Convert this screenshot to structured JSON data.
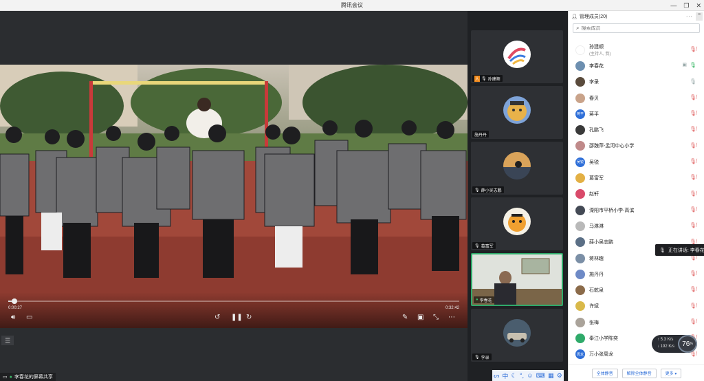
{
  "window": {
    "title": "腾讯会议",
    "controls": [
      "—",
      "❐",
      "✕"
    ]
  },
  "video": {
    "time_current": "0:00:27",
    "time_total": "0:32:42",
    "progress": 0.014,
    "share_label": "李春花的屏幕共享"
  },
  "strip": {
    "tiles": [
      {
        "name": "孙建顺",
        "icon": "host-avatar-icon"
      },
      {
        "name": "施丹丹",
        "icon": ""
      },
      {
        "name": "薛小吴志鹏",
        "icon": "mic-icon"
      },
      {
        "name": "葛富军",
        "icon": "mic-icon"
      },
      {
        "name": "李春花",
        "icon": "mic-icon"
      },
      {
        "name": "李录",
        "icon": "mic-icon"
      }
    ],
    "toolbar_chars": [
      "中"
    ]
  },
  "panel": {
    "title": "管理成员(20)",
    "more": "···",
    "search_placeholder": "搜索成员",
    "members": [
      {
        "name": "孙建顺",
        "sub": "(主持人, 我)",
        "avatar_text": "",
        "avatar_color": "#ffffff",
        "mic": "muted"
      },
      {
        "name": "李春花",
        "sub": "",
        "avatar_text": "",
        "avatar_color": "#6d8fb0",
        "mic": "green"
      },
      {
        "name": "李录",
        "sub": "",
        "avatar_text": "",
        "avatar_color": "#5a4b3c",
        "mic": "on"
      },
      {
        "name": "春贝",
        "sub": "",
        "avatar_text": "",
        "avatar_color": "#c9a38a",
        "mic": "muted"
      },
      {
        "name": "蒋平",
        "sub": "",
        "avatar_text": "蒋平",
        "avatar_color": "#2f6fd8",
        "mic": "muted"
      },
      {
        "name": "孔鹏飞",
        "sub": "",
        "avatar_text": "",
        "avatar_color": "#3a3a3a",
        "mic": "muted"
      },
      {
        "name": "邵魏萍-孟河中心小学",
        "sub": "",
        "avatar_text": "",
        "avatar_color": "#c08a8a",
        "mic": "muted"
      },
      {
        "name": "吴锐",
        "sub": "",
        "avatar_text": "吴锐",
        "avatar_color": "#2f6fd8",
        "mic": "muted"
      },
      {
        "name": "葛富军",
        "sub": "",
        "avatar_text": "",
        "avatar_color": "#e3b044",
        "mic": "muted"
      },
      {
        "name": "赵轩",
        "sub": "",
        "avatar_text": "",
        "avatar_color": "#d94a6a",
        "mic": "muted"
      },
      {
        "name": "溧阳市平桥小学-高滨",
        "sub": "",
        "avatar_text": "",
        "avatar_color": "#444a55",
        "mic": "muted"
      },
      {
        "name": "马淋淋",
        "sub": "",
        "avatar_text": "",
        "avatar_color": "#b9b9b9",
        "mic": "muted"
      },
      {
        "name": "薛小吴志鹏",
        "sub": "",
        "avatar_text": "",
        "avatar_color": "#5b6f86",
        "mic": "muted"
      },
      {
        "name": "蒋林趣",
        "sub": "",
        "avatar_text": "",
        "avatar_color": "#7b8fa6",
        "mic": "muted"
      },
      {
        "name": "施丹丹",
        "sub": "",
        "avatar_text": "",
        "avatar_color": "#6e8ac6",
        "mic": "muted"
      },
      {
        "name": "石乾泉",
        "sub": "",
        "avatar_text": "",
        "avatar_color": "#8b6b4a",
        "mic": "muted"
      },
      {
        "name": "许斌",
        "sub": "",
        "avatar_text": "",
        "avatar_color": "#d9b94a",
        "mic": "muted"
      },
      {
        "name": "张梅",
        "sub": "",
        "avatar_text": "",
        "avatar_color": "#aaa39a",
        "mic": "muted"
      },
      {
        "name": "奉江小学陈奕",
        "sub": "",
        "avatar_text": "",
        "avatar_color": "#2faa6a",
        "mic": "muted"
      },
      {
        "name": "万小张周龙",
        "sub": "",
        "avatar_text": "周龙",
        "avatar_color": "#2f6fd8",
        "mic": "muted"
      }
    ],
    "buttons": [
      "全体静音",
      "解除全体静音",
      "更多 ▾"
    ]
  },
  "speaking": {
    "label": "正在讲话: 李春花"
  },
  "network": {
    "up": "5.3",
    "up_unit": "K/s",
    "down": "192",
    "down_unit": "K/s",
    "score": "76",
    "score_unit": "%"
  }
}
